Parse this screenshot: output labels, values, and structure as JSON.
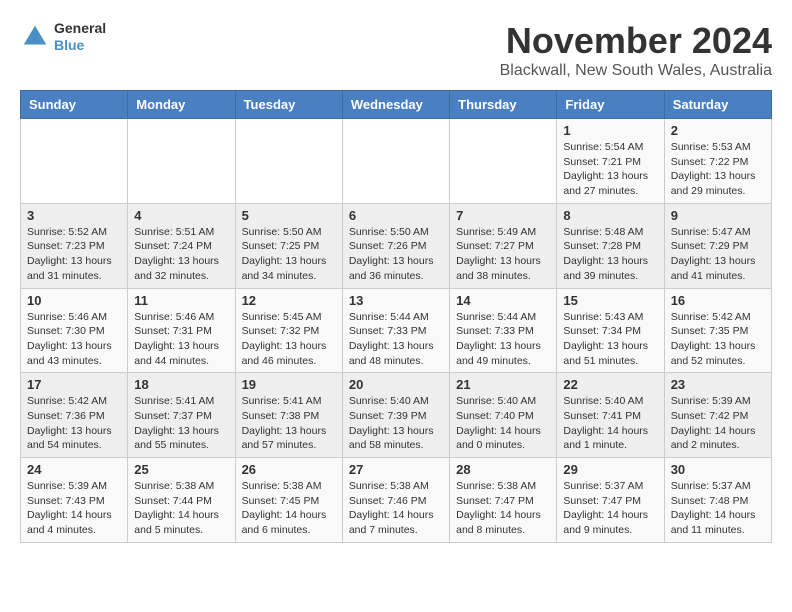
{
  "header": {
    "logo": {
      "general": "General",
      "blue": "Blue"
    },
    "title": "November 2024",
    "location": "Blackwall, New South Wales, Australia"
  },
  "days_of_week": [
    "Sunday",
    "Monday",
    "Tuesday",
    "Wednesday",
    "Thursday",
    "Friday",
    "Saturday"
  ],
  "weeks": [
    {
      "days": [
        {
          "number": "",
          "info": ""
        },
        {
          "number": "",
          "info": ""
        },
        {
          "number": "",
          "info": ""
        },
        {
          "number": "",
          "info": ""
        },
        {
          "number": "",
          "info": ""
        },
        {
          "number": "1",
          "info": "Sunrise: 5:54 AM\nSunset: 7:21 PM\nDaylight: 13 hours and 27 minutes."
        },
        {
          "number": "2",
          "info": "Sunrise: 5:53 AM\nSunset: 7:22 PM\nDaylight: 13 hours and 29 minutes."
        }
      ]
    },
    {
      "days": [
        {
          "number": "3",
          "info": "Sunrise: 5:52 AM\nSunset: 7:23 PM\nDaylight: 13 hours and 31 minutes."
        },
        {
          "number": "4",
          "info": "Sunrise: 5:51 AM\nSunset: 7:24 PM\nDaylight: 13 hours and 32 minutes."
        },
        {
          "number": "5",
          "info": "Sunrise: 5:50 AM\nSunset: 7:25 PM\nDaylight: 13 hours and 34 minutes."
        },
        {
          "number": "6",
          "info": "Sunrise: 5:50 AM\nSunset: 7:26 PM\nDaylight: 13 hours and 36 minutes."
        },
        {
          "number": "7",
          "info": "Sunrise: 5:49 AM\nSunset: 7:27 PM\nDaylight: 13 hours and 38 minutes."
        },
        {
          "number": "8",
          "info": "Sunrise: 5:48 AM\nSunset: 7:28 PM\nDaylight: 13 hours and 39 minutes."
        },
        {
          "number": "9",
          "info": "Sunrise: 5:47 AM\nSunset: 7:29 PM\nDaylight: 13 hours and 41 minutes."
        }
      ]
    },
    {
      "days": [
        {
          "number": "10",
          "info": "Sunrise: 5:46 AM\nSunset: 7:30 PM\nDaylight: 13 hours and 43 minutes."
        },
        {
          "number": "11",
          "info": "Sunrise: 5:46 AM\nSunset: 7:31 PM\nDaylight: 13 hours and 44 minutes."
        },
        {
          "number": "12",
          "info": "Sunrise: 5:45 AM\nSunset: 7:32 PM\nDaylight: 13 hours and 46 minutes."
        },
        {
          "number": "13",
          "info": "Sunrise: 5:44 AM\nSunset: 7:33 PM\nDaylight: 13 hours and 48 minutes."
        },
        {
          "number": "14",
          "info": "Sunrise: 5:44 AM\nSunset: 7:33 PM\nDaylight: 13 hours and 49 minutes."
        },
        {
          "number": "15",
          "info": "Sunrise: 5:43 AM\nSunset: 7:34 PM\nDaylight: 13 hours and 51 minutes."
        },
        {
          "number": "16",
          "info": "Sunrise: 5:42 AM\nSunset: 7:35 PM\nDaylight: 13 hours and 52 minutes."
        }
      ]
    },
    {
      "days": [
        {
          "number": "17",
          "info": "Sunrise: 5:42 AM\nSunset: 7:36 PM\nDaylight: 13 hours and 54 minutes."
        },
        {
          "number": "18",
          "info": "Sunrise: 5:41 AM\nSunset: 7:37 PM\nDaylight: 13 hours and 55 minutes."
        },
        {
          "number": "19",
          "info": "Sunrise: 5:41 AM\nSunset: 7:38 PM\nDaylight: 13 hours and 57 minutes."
        },
        {
          "number": "20",
          "info": "Sunrise: 5:40 AM\nSunset: 7:39 PM\nDaylight: 13 hours and 58 minutes."
        },
        {
          "number": "21",
          "info": "Sunrise: 5:40 AM\nSunset: 7:40 PM\nDaylight: 14 hours and 0 minutes."
        },
        {
          "number": "22",
          "info": "Sunrise: 5:40 AM\nSunset: 7:41 PM\nDaylight: 14 hours and 1 minute."
        },
        {
          "number": "23",
          "info": "Sunrise: 5:39 AM\nSunset: 7:42 PM\nDaylight: 14 hours and 2 minutes."
        }
      ]
    },
    {
      "days": [
        {
          "number": "24",
          "info": "Sunrise: 5:39 AM\nSunset: 7:43 PM\nDaylight: 14 hours and 4 minutes."
        },
        {
          "number": "25",
          "info": "Sunrise: 5:38 AM\nSunset: 7:44 PM\nDaylight: 14 hours and 5 minutes."
        },
        {
          "number": "26",
          "info": "Sunrise: 5:38 AM\nSunset: 7:45 PM\nDaylight: 14 hours and 6 minutes."
        },
        {
          "number": "27",
          "info": "Sunrise: 5:38 AM\nSunset: 7:46 PM\nDaylight: 14 hours and 7 minutes."
        },
        {
          "number": "28",
          "info": "Sunrise: 5:38 AM\nSunset: 7:47 PM\nDaylight: 14 hours and 8 minutes."
        },
        {
          "number": "29",
          "info": "Sunrise: 5:37 AM\nSunset: 7:47 PM\nDaylight: 14 hours and 9 minutes."
        },
        {
          "number": "30",
          "info": "Sunrise: 5:37 AM\nSunset: 7:48 PM\nDaylight: 14 hours and 11 minutes."
        }
      ]
    }
  ]
}
